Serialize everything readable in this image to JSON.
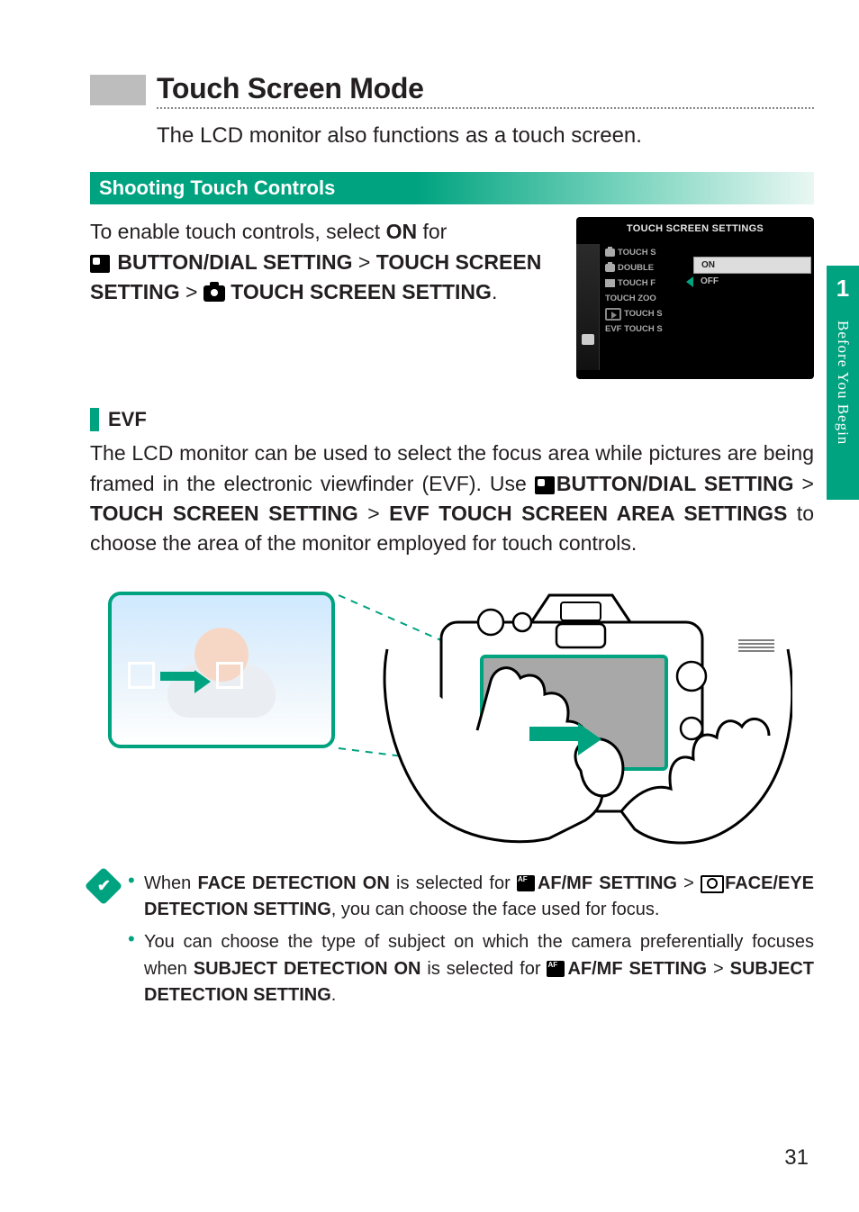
{
  "sidebar": {
    "chapter": "1",
    "label": "Before You Begin"
  },
  "heading": {
    "title": "Touch Screen Mode",
    "lead": "The LCD monitor also functions as a touch screen."
  },
  "section_bar": "Shooting Touch Controls",
  "intro": {
    "pre": "To enable touch controls, select ",
    "on": "ON",
    "post1": " for ",
    "path1": "BUTTON/DIAL SETTING",
    "gt1": " > ",
    "path2": "TOUCH SCREEN SETTING",
    "gt2": " > ",
    "path3": " TOUCH SCREEN SETTING",
    "period": "."
  },
  "menu": {
    "title": "TOUCH SCREEN SETTINGS",
    "items": [
      "TOUCH SCREEN",
      "DOUBLE TAP",
      "TOUCH FUNCTION",
      "TOUCH ZOOM",
      "TOUCH SCREEN",
      "EVF TOUCH SCREEN"
    ],
    "items_display": [
      "TOUCH S",
      "DOUBLE",
      "TOUCH F",
      "TOUCH ZOO",
      "TOUCH S",
      "EVF TOUCH S"
    ],
    "options": [
      "ON",
      "OFF"
    ],
    "selected": 0
  },
  "evf": {
    "label": "EVF",
    "para_parts": {
      "p1": "The LCD monitor can be used to select the focus area while pictures are being framed in the electronic viewfinder (EVF). Use ",
      "path1": "BUTTON/DIAL SETTING",
      "gt1": " > ",
      "path2": "TOUCH SCREEN SETTING",
      "gt2": " > ",
      "path3": "EVF TOUCH SCREEN AREA SETTINGS",
      "p2": " to choose the area of the monitor employed for touch controls."
    }
  },
  "tips": {
    "bullet1": {
      "a": "When ",
      "b": "FACE DETECTION ON",
      "c": " is selected for ",
      "d": "AF/MF SETTING",
      "gt": " > ",
      "e": "FACE/EYE DETECTION SETTING",
      "f": ", you can choose the face used for focus."
    },
    "bullet2": {
      "a": "You can choose the type of subject on which the camera preferentially focuses when ",
      "b": "SUBJECT DETECTION ON",
      "c": " is selected for ",
      "d": "AF/MF SETTING",
      "gt": " > ",
      "e": "SUBJECT DETECTION SETTING",
      "f": "."
    }
  },
  "page_number": "31"
}
